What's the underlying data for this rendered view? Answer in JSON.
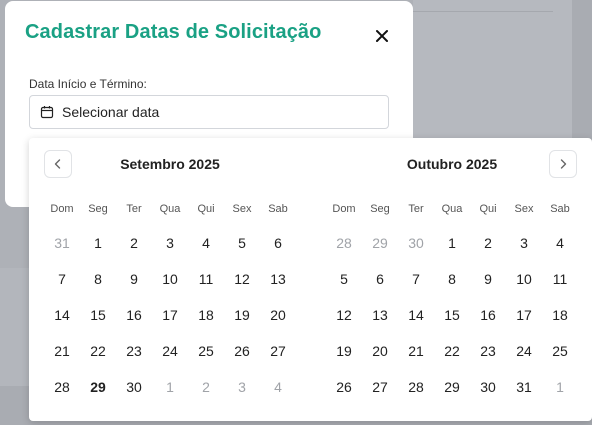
{
  "modal": {
    "title": "Cadastrar Datas de Solicitação",
    "field_label": "Data Início e Término:",
    "date_placeholder": "Selecionar data"
  },
  "calendar": {
    "weekdays": [
      "Dom",
      "Seg",
      "Ter",
      "Qua",
      "Qui",
      "Sex",
      "Sab"
    ],
    "months": [
      {
        "title": "Setembro 2025",
        "weeks": [
          [
            {
              "d": "31",
              "m": true
            },
            {
              "d": "1"
            },
            {
              "d": "2"
            },
            {
              "d": "3"
            },
            {
              "d": "4"
            },
            {
              "d": "5"
            },
            {
              "d": "6"
            }
          ],
          [
            {
              "d": "7"
            },
            {
              "d": "8"
            },
            {
              "d": "9"
            },
            {
              "d": "10"
            },
            {
              "d": "11"
            },
            {
              "d": "12"
            },
            {
              "d": "13"
            }
          ],
          [
            {
              "d": "14"
            },
            {
              "d": "15"
            },
            {
              "d": "16"
            },
            {
              "d": "17"
            },
            {
              "d": "18"
            },
            {
              "d": "19"
            },
            {
              "d": "20"
            }
          ],
          [
            {
              "d": "21"
            },
            {
              "d": "22"
            },
            {
              "d": "23"
            },
            {
              "d": "24"
            },
            {
              "d": "25"
            },
            {
              "d": "26"
            },
            {
              "d": "27"
            }
          ],
          [
            {
              "d": "28"
            },
            {
              "d": "29",
              "t": true
            },
            {
              "d": "30"
            },
            {
              "d": "1",
              "m": true
            },
            {
              "d": "2",
              "m": true
            },
            {
              "d": "3",
              "m": true
            },
            {
              "d": "4",
              "m": true
            }
          ]
        ]
      },
      {
        "title": "Outubro 2025",
        "weeks": [
          [
            {
              "d": "28",
              "m": true
            },
            {
              "d": "29",
              "m": true
            },
            {
              "d": "30",
              "m": true
            },
            {
              "d": "1"
            },
            {
              "d": "2"
            },
            {
              "d": "3"
            },
            {
              "d": "4"
            }
          ],
          [
            {
              "d": "5"
            },
            {
              "d": "6"
            },
            {
              "d": "7"
            },
            {
              "d": "8"
            },
            {
              "d": "9"
            },
            {
              "d": "10"
            },
            {
              "d": "11"
            }
          ],
          [
            {
              "d": "12"
            },
            {
              "d": "13"
            },
            {
              "d": "14"
            },
            {
              "d": "15"
            },
            {
              "d": "16"
            },
            {
              "d": "17"
            },
            {
              "d": "18"
            }
          ],
          [
            {
              "d": "19"
            },
            {
              "d": "20"
            },
            {
              "d": "21"
            },
            {
              "d": "22"
            },
            {
              "d": "23"
            },
            {
              "d": "24"
            },
            {
              "d": "25"
            }
          ],
          [
            {
              "d": "26"
            },
            {
              "d": "27"
            },
            {
              "d": "28"
            },
            {
              "d": "29"
            },
            {
              "d": "30"
            },
            {
              "d": "31"
            },
            {
              "d": "1",
              "m": true
            }
          ]
        ]
      }
    ]
  },
  "icons": {
    "close": "close-icon",
    "calendar": "calendar-icon",
    "prev": "chevron-left-icon",
    "next": "chevron-right-icon"
  },
  "colors": {
    "title": "#1aa184",
    "overlay": "#aeb1b7"
  }
}
